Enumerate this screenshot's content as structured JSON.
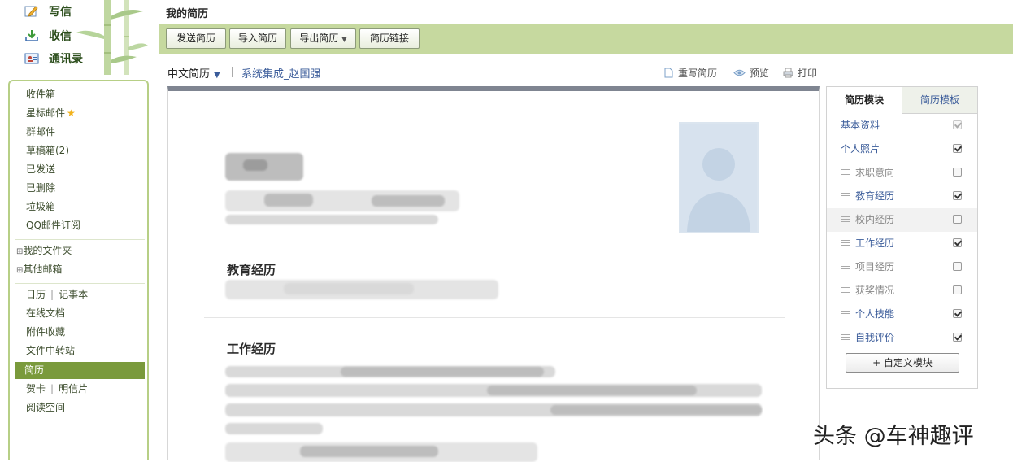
{
  "compose": {
    "write": "写信",
    "receive": "收信",
    "contacts": "通讯录"
  },
  "folders": {
    "inbox": "收件箱",
    "starred": "星标邮件",
    "group": "群邮件",
    "drafts": "草稿箱(2)",
    "sent": "已发送",
    "deleted": "已删除",
    "spam": "垃圾箱",
    "qq_sub": "QQ邮件订阅",
    "my_folders": "我的文件夹",
    "other_mailbox": "其他邮箱",
    "calendar": "日历",
    "notebook": "记事本",
    "online_docs": "在线文档",
    "attachments": "附件收藏",
    "transfer": "文件中转站",
    "resume": "简历",
    "greeting": "贺卡",
    "postcard": "明信片",
    "reading": "阅读空间"
  },
  "page": {
    "title": "我的简历"
  },
  "toolbar": {
    "send": "发送简历",
    "import": "导入简历",
    "export": "导出简历",
    "link": "简历链接"
  },
  "resume": {
    "language": "中文简历",
    "name": "系统集成_赵国强",
    "rewrite": "重写简历",
    "preview": "预览",
    "print": "打印",
    "sec_education": "教育经历",
    "sec_work": "工作经历"
  },
  "panel": {
    "tab_modules": "简历模块",
    "tab_templates": "简历模板",
    "modules": [
      {
        "label": "基本资料",
        "checked": true,
        "disabled": true
      },
      {
        "label": "个人照片",
        "checked": true,
        "disabled": false
      },
      {
        "label": "求职意向",
        "checked": false,
        "disabled": false
      },
      {
        "label": "教育经历",
        "checked": true,
        "disabled": false
      },
      {
        "label": "校内经历",
        "checked": false,
        "disabled": false
      },
      {
        "label": "工作经历",
        "checked": true,
        "disabled": false
      },
      {
        "label": "项目经历",
        "checked": false,
        "disabled": false
      },
      {
        "label": "获奖情况",
        "checked": false,
        "disabled": false
      },
      {
        "label": "个人技能",
        "checked": true,
        "disabled": false
      },
      {
        "label": "自我评价",
        "checked": true,
        "disabled": false
      }
    ],
    "add_module": "+ 自定义模块"
  },
  "watermark": "头条 @车神趣评",
  "colors": {
    "toolbar_bg": "#c6d99f",
    "selected_bg": "#7a9a3c",
    "link": "#3b5c9a"
  }
}
